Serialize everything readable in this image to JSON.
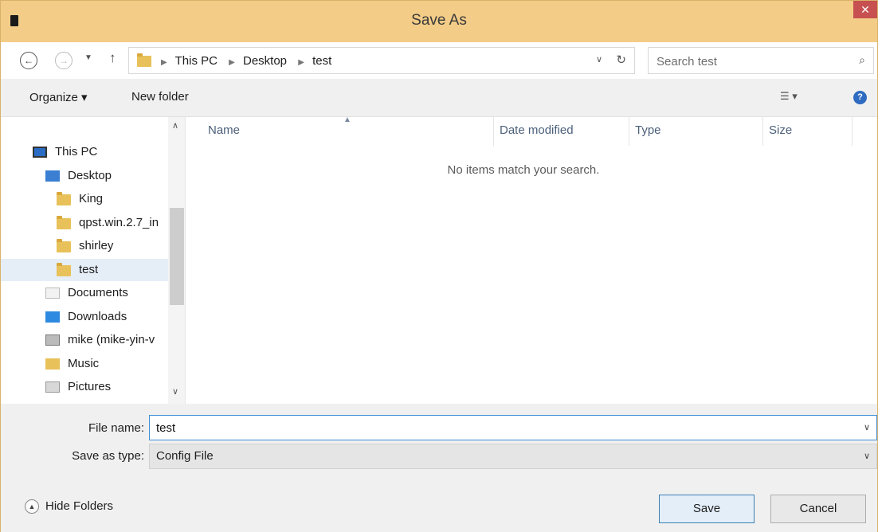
{
  "window": {
    "title": "Save As",
    "close_glyph": "✕"
  },
  "address": {
    "crumbs": [
      "This PC",
      "Desktop",
      "test"
    ],
    "search_placeholder": "Search test"
  },
  "command_bar": {
    "organize": "Organize ▾",
    "new_folder": "New folder"
  },
  "nav_pane": {
    "items": [
      {
        "label": "This PC",
        "icon": "computer-icon"
      },
      {
        "label": "Desktop",
        "icon": "desktop-icon"
      },
      {
        "label": "King",
        "icon": "folder-icon"
      },
      {
        "label": "qpst.win.2.7_in",
        "icon": "folder-icon"
      },
      {
        "label": "shirley",
        "icon": "folder-icon"
      },
      {
        "label": "test",
        "icon": "folder-icon",
        "selected": true
      },
      {
        "label": "Documents",
        "icon": "documents-icon"
      },
      {
        "label": "Downloads",
        "icon": "downloads-icon"
      },
      {
        "label": "mike (mike-yin-v",
        "icon": "network-drive-icon"
      },
      {
        "label": "Music",
        "icon": "music-icon"
      },
      {
        "label": "Pictures",
        "icon": "pictures-icon"
      }
    ]
  },
  "file_list": {
    "columns": [
      "Name",
      "Date modified",
      "Type",
      "Size"
    ],
    "empty_message": "No items match your search."
  },
  "form": {
    "file_name_label": "File name:",
    "file_name_value": "test",
    "save_type_label": "Save as type:",
    "save_type_value": "Config File"
  },
  "footer": {
    "hide_folders": "Hide Folders",
    "save": "Save",
    "cancel": "Cancel"
  },
  "colors": {
    "titlebar": "#f3cc87",
    "close": "#c75050",
    "accent": "#3e8fd7"
  }
}
